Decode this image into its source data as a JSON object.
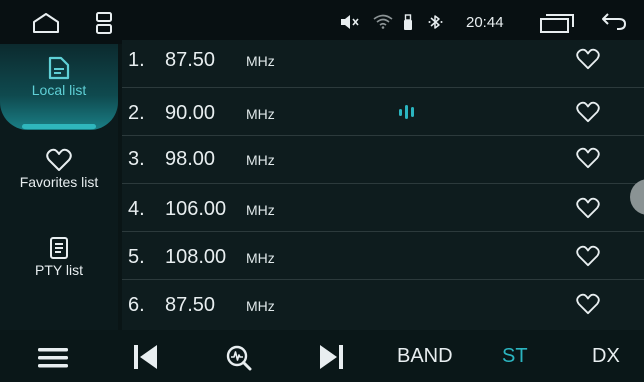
{
  "status_bar": {
    "time": "20:44",
    "icons": [
      "home-icon",
      "recent-apps-icon",
      "volume-mute-icon",
      "wifi-icon",
      "usb-icon",
      "bluetooth-icon",
      "window-icon",
      "back-icon"
    ]
  },
  "sidebar": {
    "items": [
      {
        "label": "Local list",
        "icon": "document-icon",
        "active": true
      },
      {
        "label": "Favorites list",
        "icon": "heart-icon",
        "active": false
      },
      {
        "label": "PTY list",
        "icon": "list-icon",
        "active": false
      }
    ]
  },
  "stations": [
    {
      "index": "1.",
      "frequency": "87.50",
      "unit": "MHz",
      "playing": false
    },
    {
      "index": "2.",
      "frequency": "90.00",
      "unit": "MHz",
      "playing": true
    },
    {
      "index": "3.",
      "frequency": "98.00",
      "unit": "MHz",
      "playing": false
    },
    {
      "index": "4.",
      "frequency": "106.00",
      "unit": "MHz",
      "playing": false
    },
    {
      "index": "5.",
      "frequency": "108.00",
      "unit": "MHz",
      "playing": false
    },
    {
      "index": "6.",
      "frequency": "87.50",
      "unit": "MHz",
      "playing": false
    }
  ],
  "toolbar": {
    "icons": [
      "menu-icon",
      "previous-icon",
      "scan-icon",
      "next-icon"
    ],
    "band_label": "BAND",
    "st_label": "ST",
    "dx_label": "DX"
  },
  "colors": {
    "accent": "#2bb5c0",
    "background": "#0a1516",
    "row": "#0e1c1e",
    "divider": "#2c3a3c"
  }
}
